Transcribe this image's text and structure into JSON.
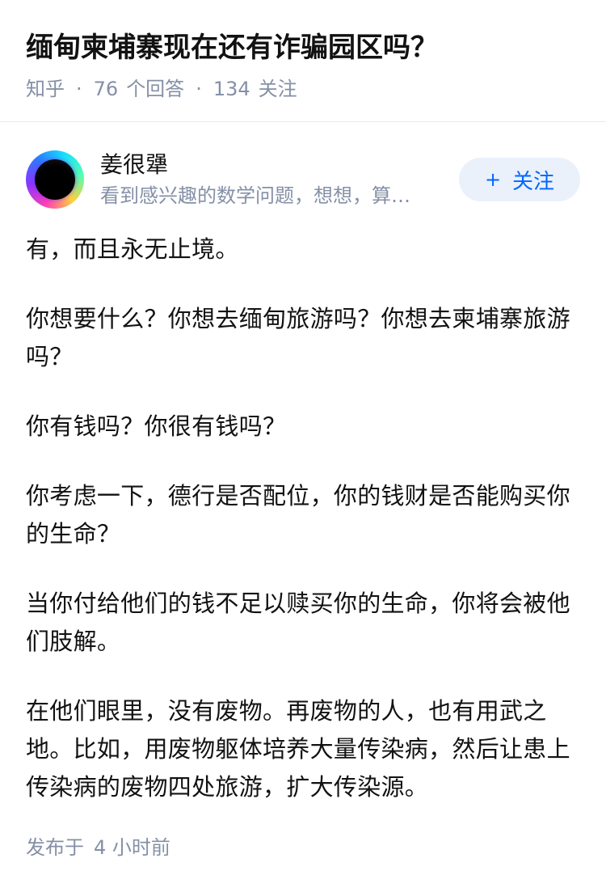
{
  "question": {
    "title": "缅甸柬埔寨现在还有诈骗园区吗？",
    "source": "知乎",
    "answer_count": "76",
    "answer_label": "个回答",
    "follower_count": "134",
    "follower_label": "关注",
    "separator": "·"
  },
  "answer": {
    "author": {
      "name": "姜很犟",
      "bio": "看到感兴趣的数学问题，想想，算…",
      "avatar_icon": "avatar-gradient-ring"
    },
    "follow_button": {
      "icon": "plus-icon",
      "plus": "+",
      "label": "关注"
    },
    "paragraphs": [
      "有，而且永无止境。",
      "你想要什么？你想去缅甸旅游吗？你想去柬埔寨旅游吗？",
      "你有钱吗？你很有钱吗？",
      "你考虑一下，德行是否配位，你的钱财是否能购买你的生命？",
      "当你付给他们的钱不足以赎买你的生命，你将会被他们肢解。",
      "在他们眼里，没有废物。再废物的人，也有用武之地。比如，用废物躯体培养大量传染病，然后让患上传染病的废物四处旅游，扩大传染源。"
    ],
    "publish_label": "发布于",
    "publish_time": "4 小时前"
  },
  "colors": {
    "text": "#121212",
    "meta": "#8590a6",
    "accent": "#0066ff",
    "button_bg": "#eaf1fb"
  }
}
